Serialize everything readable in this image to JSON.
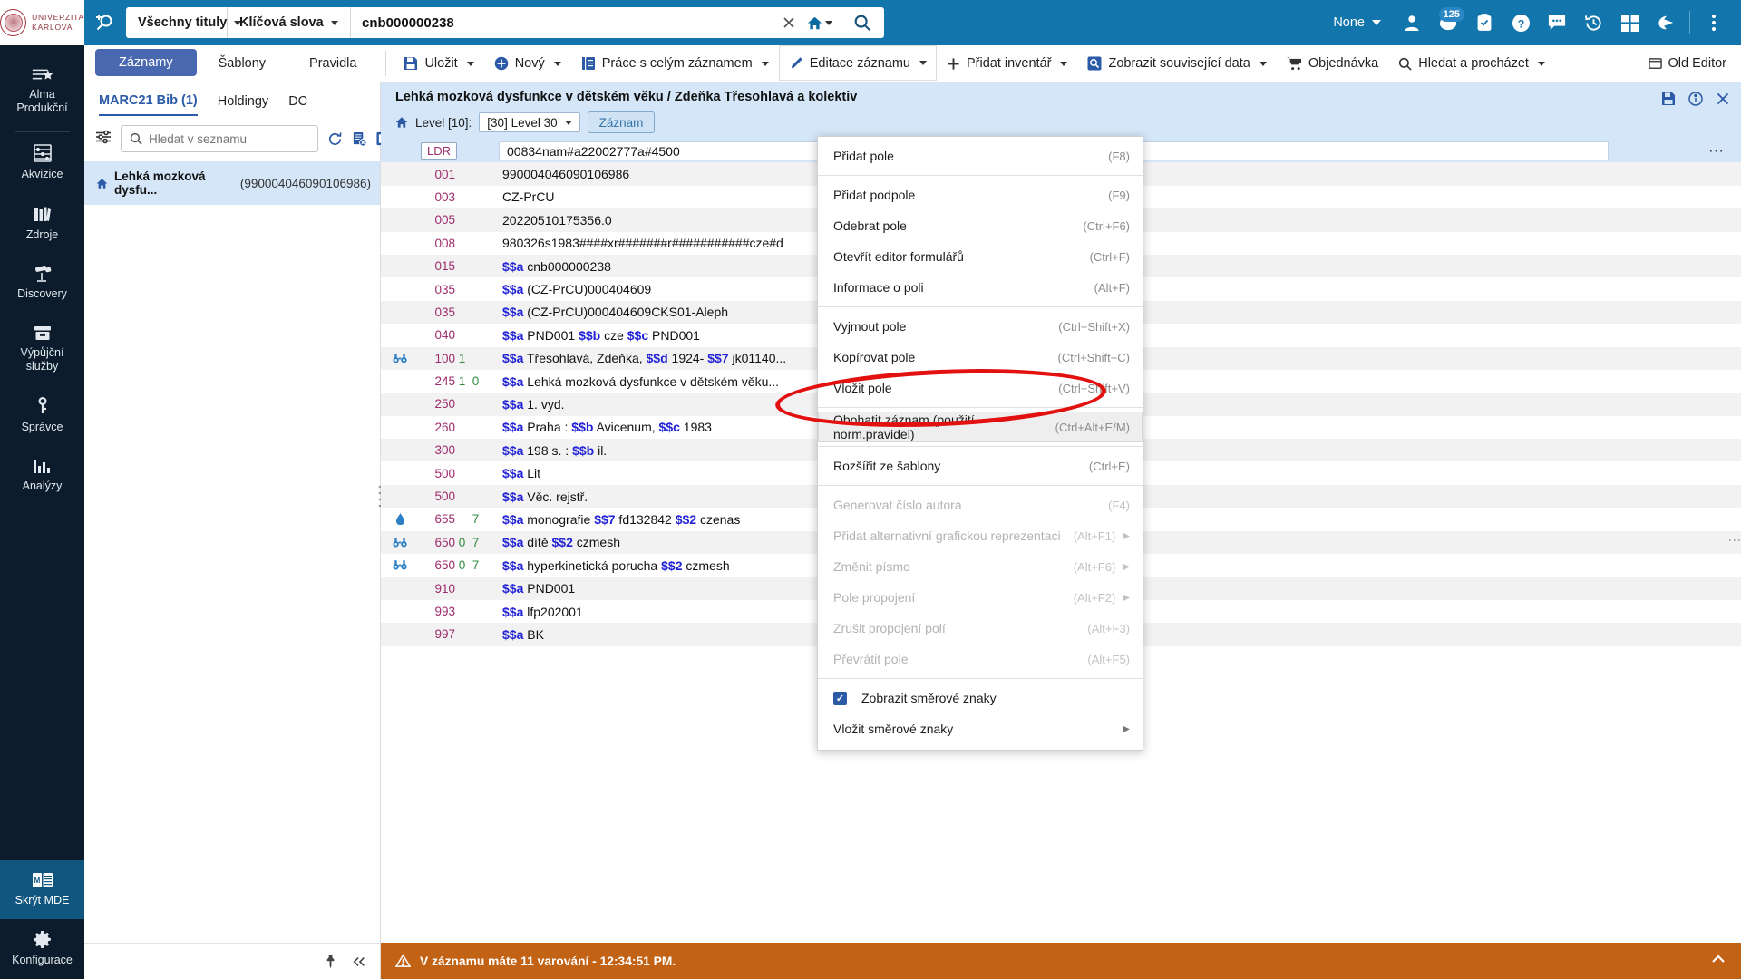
{
  "header": {
    "logo_line1": "UNIVERZITA",
    "logo_line2": "KARLOVA",
    "search": {
      "scope_label": "Všechny tituly",
      "field_label": "Klíčová slova",
      "value": "cnb000000238",
      "placeholder": ""
    },
    "right": {
      "institution_label": "None",
      "notification_count": "125"
    },
    "icons": {
      "new_search": "new-search-icon",
      "clear": "clear-icon",
      "home": "home-icon",
      "go": "search-icon",
      "user": "user-icon",
      "tasks": "tasks-icon",
      "help": "help-icon",
      "chat": "chat-icon",
      "recent": "history-icon",
      "apps": "apps-icon",
      "feedback": "feedback-icon",
      "more": "more-vertical-icon"
    }
  },
  "sidebar": {
    "items": [
      {
        "label": "Alma\nProdukční",
        "icon": "alma-icon",
        "active": false
      },
      {
        "label": "Akvizice",
        "icon": "acquisitions-icon",
        "active": false
      },
      {
        "label": "Zdroje",
        "icon": "resources-icon",
        "active": false
      },
      {
        "label": "Discovery",
        "icon": "discovery-icon",
        "active": false
      },
      {
        "label": "Výpůjční\nslužby",
        "icon": "fulfillment-icon",
        "active": false
      },
      {
        "label": "Správce",
        "icon": "admin-icon",
        "active": false
      },
      {
        "label": "Analýzy",
        "icon": "analytics-icon",
        "active": false
      }
    ],
    "bottom": [
      {
        "label": "Skrýt MDE",
        "icon": "mde-icon",
        "active": true
      },
      {
        "label": "Konfigurace",
        "icon": "gear-icon",
        "active": false
      }
    ]
  },
  "toolbar": {
    "tabs": [
      {
        "label": "Záznamy",
        "active": true
      },
      {
        "label": "Šablony",
        "active": false
      },
      {
        "label": "Pravidla",
        "active": false
      }
    ],
    "buttons": [
      {
        "label": "Uložit",
        "icon": "save-icon",
        "caret": true,
        "open": false
      },
      {
        "label": "Nový",
        "icon": "plus-circle-icon",
        "caret": true,
        "open": false
      },
      {
        "label": "Práce s celým záznamem",
        "icon": "record-icon",
        "caret": true,
        "open": false
      },
      {
        "label": "Editace záznamu",
        "icon": "pencil-icon",
        "caret": true,
        "open": true
      },
      {
        "label": "Přidat inventář",
        "icon": "plus-icon",
        "caret": true,
        "open": false
      },
      {
        "label": "Zobrazit související data",
        "icon": "related-data-icon",
        "caret": true,
        "open": false
      },
      {
        "label": "Objednávka",
        "icon": "cart-icon",
        "caret": false,
        "open": false
      },
      {
        "label": "Hledat a procházet",
        "icon": "search-icon",
        "caret": true,
        "open": false
      }
    ],
    "old_editor_label": "Old Editor"
  },
  "left_pane": {
    "tabs": [
      {
        "label": "MARC21 Bib (1)",
        "active": true
      },
      {
        "label": "Holdingy",
        "active": false
      },
      {
        "label": "DC",
        "active": false
      }
    ],
    "search_placeholder": "Hledat v seznamu",
    "search_value": "",
    "icons": {
      "filter": "filter-icon",
      "search": "search-icon",
      "refresh": "refresh-icon",
      "clear_list": "clear-list-icon",
      "split_view": "split-view-icon",
      "pin": "pin-icon",
      "collapse": "collapse-icon"
    },
    "list": [
      {
        "title": "Lehká mozková dysfu...",
        "mms": "(990004046090106986)",
        "home": true,
        "selected": true
      }
    ]
  },
  "record": {
    "title": "Lehká mozková dysfunkce v dětském věku / Zdeňka Třesohlavá a kolektiv",
    "level_label": "Level [10]:",
    "level_value": "[30] Level 30",
    "record_button": "Záznam",
    "header_icons": {
      "save": "save-icon",
      "info": "info-icon",
      "close": "close-icon"
    },
    "fields": [
      {
        "icon": "",
        "tag": "LDR",
        "i1": "",
        "i2": "",
        "value": "00834nam#a22002777a#4500",
        "boxed": true,
        "selected": true
      },
      {
        "icon": "",
        "tag": "001",
        "i1": "",
        "i2": "",
        "value": "990004046090106986"
      },
      {
        "icon": "",
        "tag": "003",
        "i1": "",
        "i2": "",
        "value": "CZ-PrCU"
      },
      {
        "icon": "",
        "tag": "005",
        "i1": "",
        "i2": "",
        "value": "20220510175356.0"
      },
      {
        "icon": "",
        "tag": "008",
        "i1": "",
        "i2": "",
        "value": "980326s1983####xr#######r###########cze#d"
      },
      {
        "icon": "",
        "tag": "015",
        "i1": "",
        "i2": "",
        "value": "$$a cnb000000238"
      },
      {
        "icon": "",
        "tag": "035",
        "i1": "",
        "i2": "",
        "value": "$$a (CZ-PrCU)000404609"
      },
      {
        "icon": "",
        "tag": "035",
        "i1": "",
        "i2": "",
        "value": "$$a (CZ-PrCU)000404609CKS01-Aleph"
      },
      {
        "icon": "",
        "tag": "040",
        "i1": "",
        "i2": "",
        "value": "$$a PND001 $$b cze $$c PND001"
      },
      {
        "icon": "binoculars-icon",
        "tag": "100",
        "i1": "1",
        "i2": "",
        "value": "$$a Třesohlavá, Zdeňka, $$d 1924- $$7 jk01140..."
      },
      {
        "icon": "",
        "tag": "245",
        "i1": "1",
        "i2": "0",
        "value": "$$a Lehká mozková dysfunkce v dětském věku..."
      },
      {
        "icon": "",
        "tag": "250",
        "i1": "",
        "i2": "",
        "value": "$$a 1. vyd."
      },
      {
        "icon": "",
        "tag": "260",
        "i1": "",
        "i2": "",
        "value": "$$a Praha : $$b Avicenum, $$c 1983"
      },
      {
        "icon": "",
        "tag": "300",
        "i1": "",
        "i2": "",
        "value": "$$a 198 s. : $$b il."
      },
      {
        "icon": "",
        "tag": "500",
        "i1": "",
        "i2": "",
        "value": "$$a Lit"
      },
      {
        "icon": "",
        "tag": "500",
        "i1": "",
        "i2": "",
        "value": "$$a Věc. rejstř."
      },
      {
        "icon": "drop-icon",
        "tag": "655",
        "i1": "",
        "i2": "7",
        "value": "$$a monografie $$7 fd132842 $$2 czenas"
      },
      {
        "icon": "binoculars-icon",
        "tag": "650",
        "i1": "0",
        "i2": "7",
        "value": "$$a dítě $$2 czmesh"
      },
      {
        "icon": "binoculars-icon",
        "tag": "650",
        "i1": "0",
        "i2": "7",
        "value": "$$a hyperkinetická porucha $$2 czmesh"
      },
      {
        "icon": "",
        "tag": "910",
        "i1": "",
        "i2": "",
        "value": "$$a PND001"
      },
      {
        "icon": "",
        "tag": "993",
        "i1": "",
        "i2": "",
        "value": "$$a lfp202001"
      },
      {
        "icon": "",
        "tag": "997",
        "i1": "",
        "i2": "",
        "value": "$$a BK"
      }
    ]
  },
  "edit_menu": {
    "items": [
      {
        "label": "Přidat pole",
        "shortcut": "(F8)",
        "disabled": false,
        "submenu": false,
        "separator_after": true
      },
      {
        "label": "Přidat podpole",
        "shortcut": "(F9)",
        "disabled": false,
        "submenu": false
      },
      {
        "label": "Odebrat pole",
        "shortcut": "(Ctrl+F6)",
        "disabled": false,
        "submenu": false
      },
      {
        "label": "Otevřít editor formulářů",
        "shortcut": "(Ctrl+F)",
        "disabled": false,
        "submenu": false
      },
      {
        "label": "Informace o poli",
        "shortcut": "(Alt+F)",
        "disabled": false,
        "submenu": false,
        "separator_after": true
      },
      {
        "label": "Vyjmout pole",
        "shortcut": "(Ctrl+Shift+X)",
        "disabled": false,
        "submenu": false
      },
      {
        "label": "Kopírovat pole",
        "shortcut": "(Ctrl+Shift+C)",
        "disabled": false,
        "submenu": false
      },
      {
        "label": "Vložit pole",
        "shortcut": "(Ctrl+Shift+V)",
        "disabled": false,
        "submenu": false,
        "separator_after": true
      },
      {
        "label": "Obohatit záznam (použití norm.pravidel)",
        "shortcut": "(Ctrl+Alt+E/M)",
        "disabled": false,
        "submenu": false,
        "highlight": true,
        "separator_after": true
      },
      {
        "label": "Rozšířit ze šablony",
        "shortcut": "(Ctrl+E)",
        "disabled": false,
        "submenu": false,
        "separator_after": true
      },
      {
        "label": "Generovat číslo autora",
        "shortcut": "(F4)",
        "disabled": true,
        "submenu": false
      },
      {
        "label": "Přidat alternativní grafickou reprezentaci",
        "shortcut": "(Alt+F1)",
        "disabled": true,
        "submenu": true
      },
      {
        "label": "Změnit písmo",
        "shortcut": "(Alt+F6)",
        "disabled": true,
        "submenu": true
      },
      {
        "label": "Pole propojení",
        "shortcut": "(Alt+F2)",
        "disabled": true,
        "submenu": true
      },
      {
        "label": "Zrušit propojení polí",
        "shortcut": "(Alt+F3)",
        "disabled": true,
        "submenu": false
      },
      {
        "label": "Převrátit pole",
        "shortcut": "(Alt+F5)",
        "disabled": true,
        "submenu": false,
        "separator_after": true
      },
      {
        "label": "Zobrazit směrové znaky",
        "shortcut": "",
        "disabled": false,
        "submenu": false,
        "checkbox": true,
        "checked": true
      },
      {
        "label": "Vložit směrové znaky",
        "shortcut": "",
        "disabled": false,
        "submenu": true
      }
    ]
  },
  "warning": {
    "icon": "warning-icon",
    "text": "V záznamu máte 11 varování - 12:34:51 PM."
  },
  "colors": {
    "header_blue": "#1275ab",
    "nav_dark": "#0c1c2c",
    "accent_blue": "#2b5aa6",
    "selection_blue": "#d4e6f7",
    "warning_orange": "#c26214",
    "annotation_red": "#e31010",
    "tag_magenta": "#9c2b6b",
    "subfield_blue": "#2323d6",
    "indicator_green": "#2e8b3d"
  }
}
